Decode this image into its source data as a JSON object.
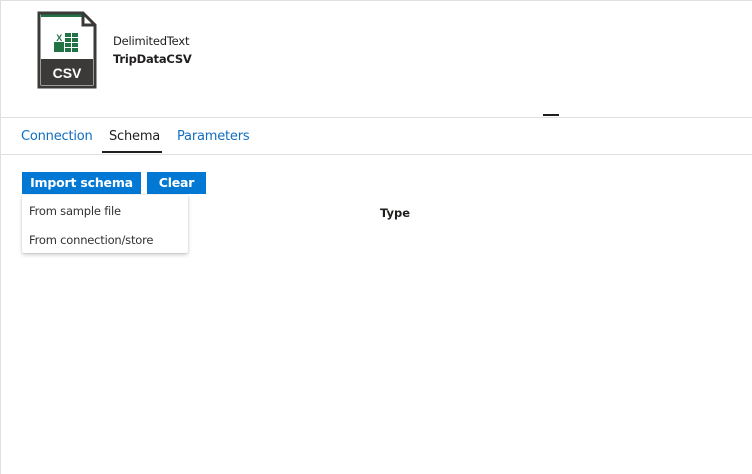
{
  "dataset": {
    "icon": "csv-file-icon",
    "icon_label": "CSV",
    "type": "DelimitedText",
    "name": "TripDataCSV"
  },
  "tabs": [
    {
      "label": "Connection",
      "active": false
    },
    {
      "label": "Schema",
      "active": true
    },
    {
      "label": "Parameters",
      "active": false
    }
  ],
  "toolbar": {
    "import_label": "Import schema",
    "clear_label": "Clear"
  },
  "import_menu": {
    "items": [
      {
        "label": "From sample file"
      },
      {
        "label": "From connection/store"
      }
    ]
  },
  "schema_table": {
    "columns": [
      "Type"
    ]
  },
  "colors": {
    "accent": "#0078d4",
    "link": "#106ebe",
    "text": "#201f1e",
    "excel_green": "#217346"
  }
}
